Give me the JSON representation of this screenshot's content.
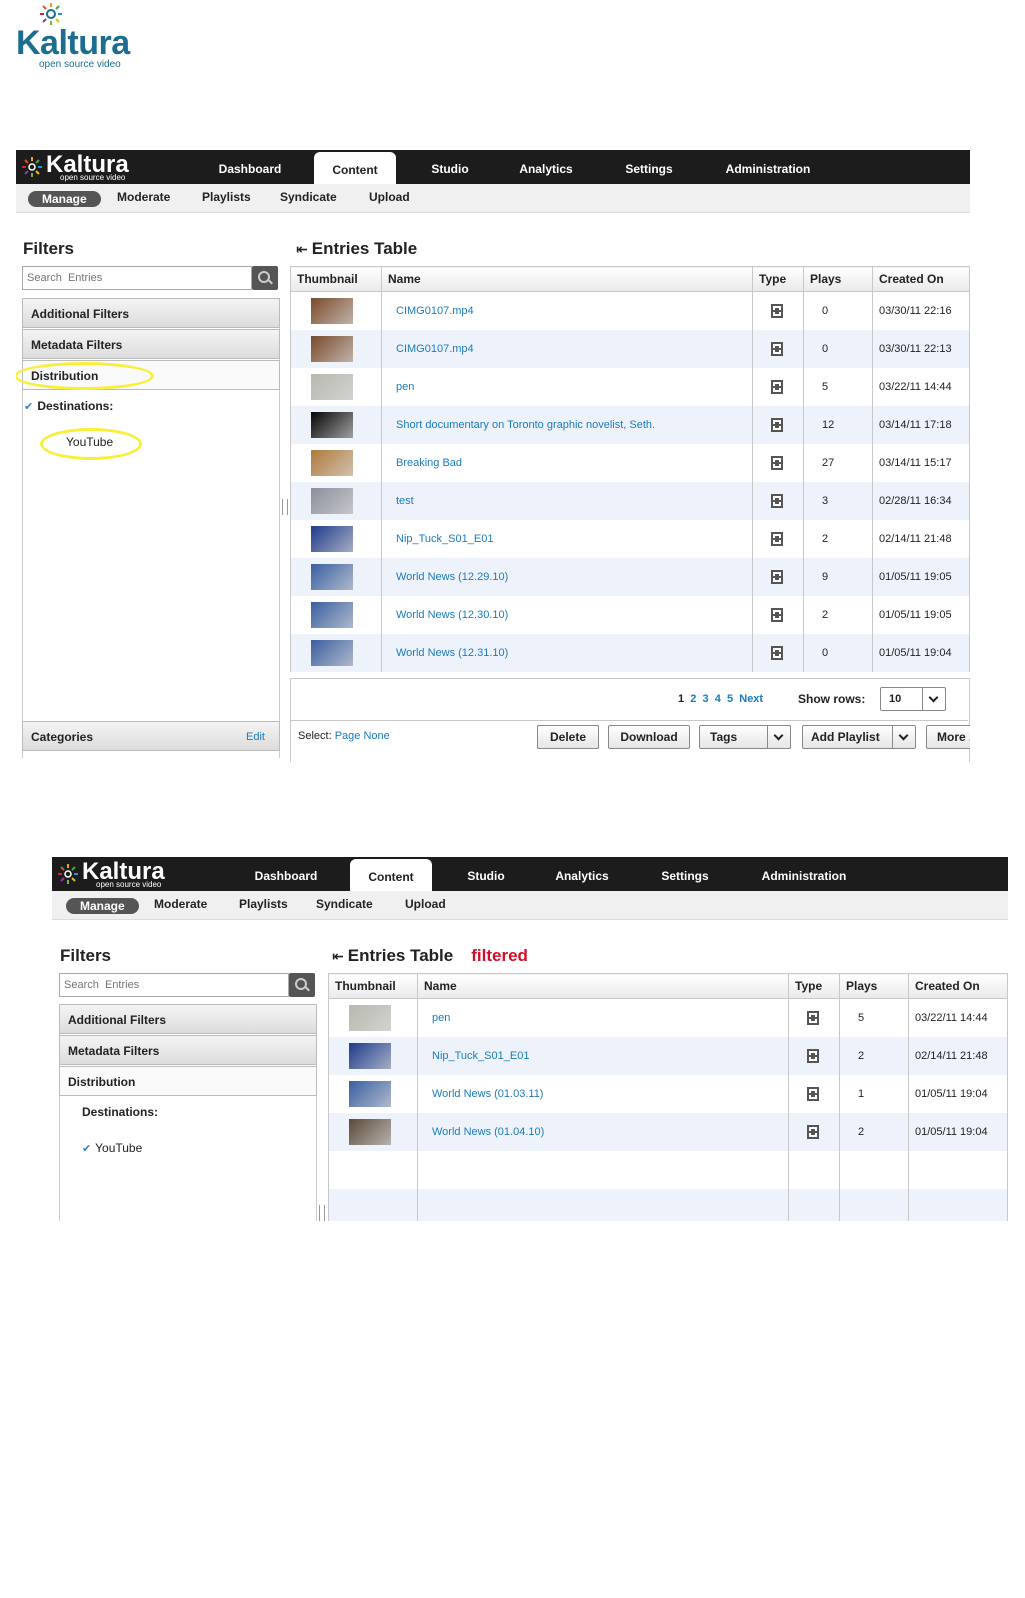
{
  "page_logo": {
    "word": "Kaltura",
    "tagline": "open source video"
  },
  "shot1": {
    "brand": {
      "word": "Kaltura",
      "tagline": "open source video"
    },
    "tabs": [
      "Dashboard",
      "Content",
      "Studio",
      "Analytics",
      "Settings",
      "Administration"
    ],
    "active_tab": "Content",
    "subtabs": [
      "Manage",
      "Moderate",
      "Playlists",
      "Syndicate",
      "Upload"
    ],
    "filters_title": "Filters",
    "search_placeholder": "Search  Entries",
    "accordions": [
      "Additional Filters",
      "Metadata Filters",
      "Distribution"
    ],
    "destinations_label": "Destinations:",
    "destination_item": "YouTube",
    "categories_label": "Categories",
    "categories_edit": "Edit",
    "table_title": "Entries Table",
    "columns": [
      "Thumbnail",
      "Name",
      "Type",
      "Plays",
      "Created On"
    ],
    "rows": [
      {
        "name": "CIMG0107.mp4",
        "plays": "0",
        "created": "03/30/11 22:16",
        "thumb": "#7a4a2a"
      },
      {
        "name": "CIMG0107.mp4",
        "plays": "0",
        "created": "03/30/11 22:13",
        "thumb": "#7a4a2a"
      },
      {
        "name": "pen",
        "plays": "5",
        "created": "03/22/11 14:44",
        "thumb": "#b8b8b0"
      },
      {
        "name": "Short documentary on Toronto graphic novelist, Seth.",
        "plays": "12",
        "created": "03/14/11 17:18",
        "thumb": "#050505"
      },
      {
        "name": "Breaking Bad",
        "plays": "27",
        "created": "03/14/11 15:17",
        "thumb": "#b07a3a"
      },
      {
        "name": "test",
        "plays": "3",
        "created": "02/28/11 16:34",
        "thumb": "#8a8f9a"
      },
      {
        "name": "Nip_Tuck_S01_E01",
        "plays": "2",
        "created": "02/14/11 21:48",
        "thumb": "#1e3a8a"
      },
      {
        "name": "World News (12.29.10)",
        "plays": "9",
        "created": "01/05/11 19:05",
        "thumb": "#3a5fa0"
      },
      {
        "name": "World News (12.30.10)",
        "plays": "2",
        "created": "01/05/11 19:05",
        "thumb": "#3a5fa0"
      },
      {
        "name": "World News (12.31.10)",
        "plays": "0",
        "created": "01/05/11 19:04",
        "thumb": "#3a5fa0"
      }
    ],
    "pager": {
      "pages": [
        "1",
        "2",
        "3",
        "4",
        "5"
      ],
      "next": "Next",
      "show_rows_label": "Show rows:",
      "show_rows_value": "10"
    },
    "select_label": "Select:",
    "select_page": "Page",
    "select_none": "None",
    "buttons": {
      "delete": "Delete",
      "download": "Download",
      "tags": "Tags",
      "add_playlist": "Add Playlist",
      "more": "More ."
    }
  },
  "shot2": {
    "brand": {
      "word": "Kaltura",
      "tagline": "open source video"
    },
    "tabs": [
      "Dashboard",
      "Content",
      "Studio",
      "Analytics",
      "Settings",
      "Administration"
    ],
    "active_tab": "Content",
    "subtabs": [
      "Manage",
      "Moderate",
      "Playlists",
      "Syndicate",
      "Upload"
    ],
    "filters_title": "Filters",
    "search_placeholder": "Search  Entries",
    "accordions": [
      "Additional Filters",
      "Metadata Filters",
      "Distribution"
    ],
    "destinations_label": "Destinations:",
    "destination_item": "YouTube",
    "table_title": "Entries Table",
    "filtered_label": "filtered",
    "columns": [
      "Thumbnail",
      "Name",
      "Type",
      "Plays",
      "Created On"
    ],
    "rows": [
      {
        "name": "pen",
        "plays": "5",
        "created": "03/22/11 14:44",
        "thumb": "#b8b8b0"
      },
      {
        "name": "Nip_Tuck_S01_E01",
        "plays": "2",
        "created": "02/14/11 21:48",
        "thumb": "#1e3a8a"
      },
      {
        "name": "World News (01.03.11)",
        "plays": "1",
        "created": "01/05/11 19:04",
        "thumb": "#3a5fa0"
      },
      {
        "name": "World News (01.04.10)",
        "plays": "2",
        "created": "01/05/11 19:04",
        "thumb": "#5a4a3a"
      }
    ]
  }
}
